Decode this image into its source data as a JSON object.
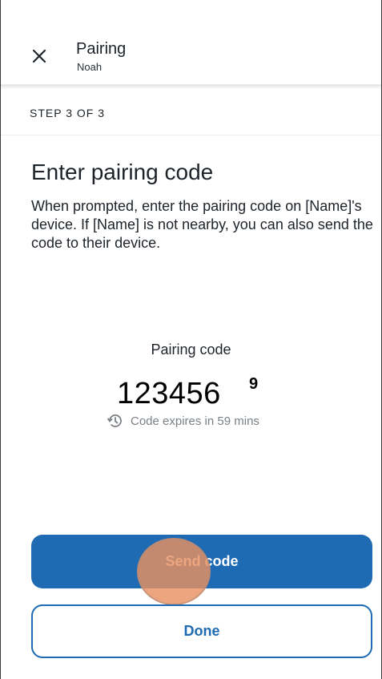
{
  "header": {
    "title": "Pairing",
    "subtitle": "Noah",
    "close_icon": "close-icon"
  },
  "step": {
    "label": "STEP 3 OF 3"
  },
  "content": {
    "heading": "Enter pairing code",
    "description": "When prompted, enter the pairing code on [Name]'s device. If [Name] is not nearby, you can also send the code to their device.",
    "code_label": "Pairing code",
    "code_value": "123456",
    "code_badge": "9",
    "expiry_icon": "timer-icon",
    "expiry_text": "Code expires in 59 mins"
  },
  "actions": {
    "send_label": "Send code",
    "done_label": "Done"
  },
  "colors": {
    "primary": "#1e6ab3",
    "text": "#1d2329",
    "muted": "#7a8086",
    "touch_indicator": "#e89161"
  }
}
